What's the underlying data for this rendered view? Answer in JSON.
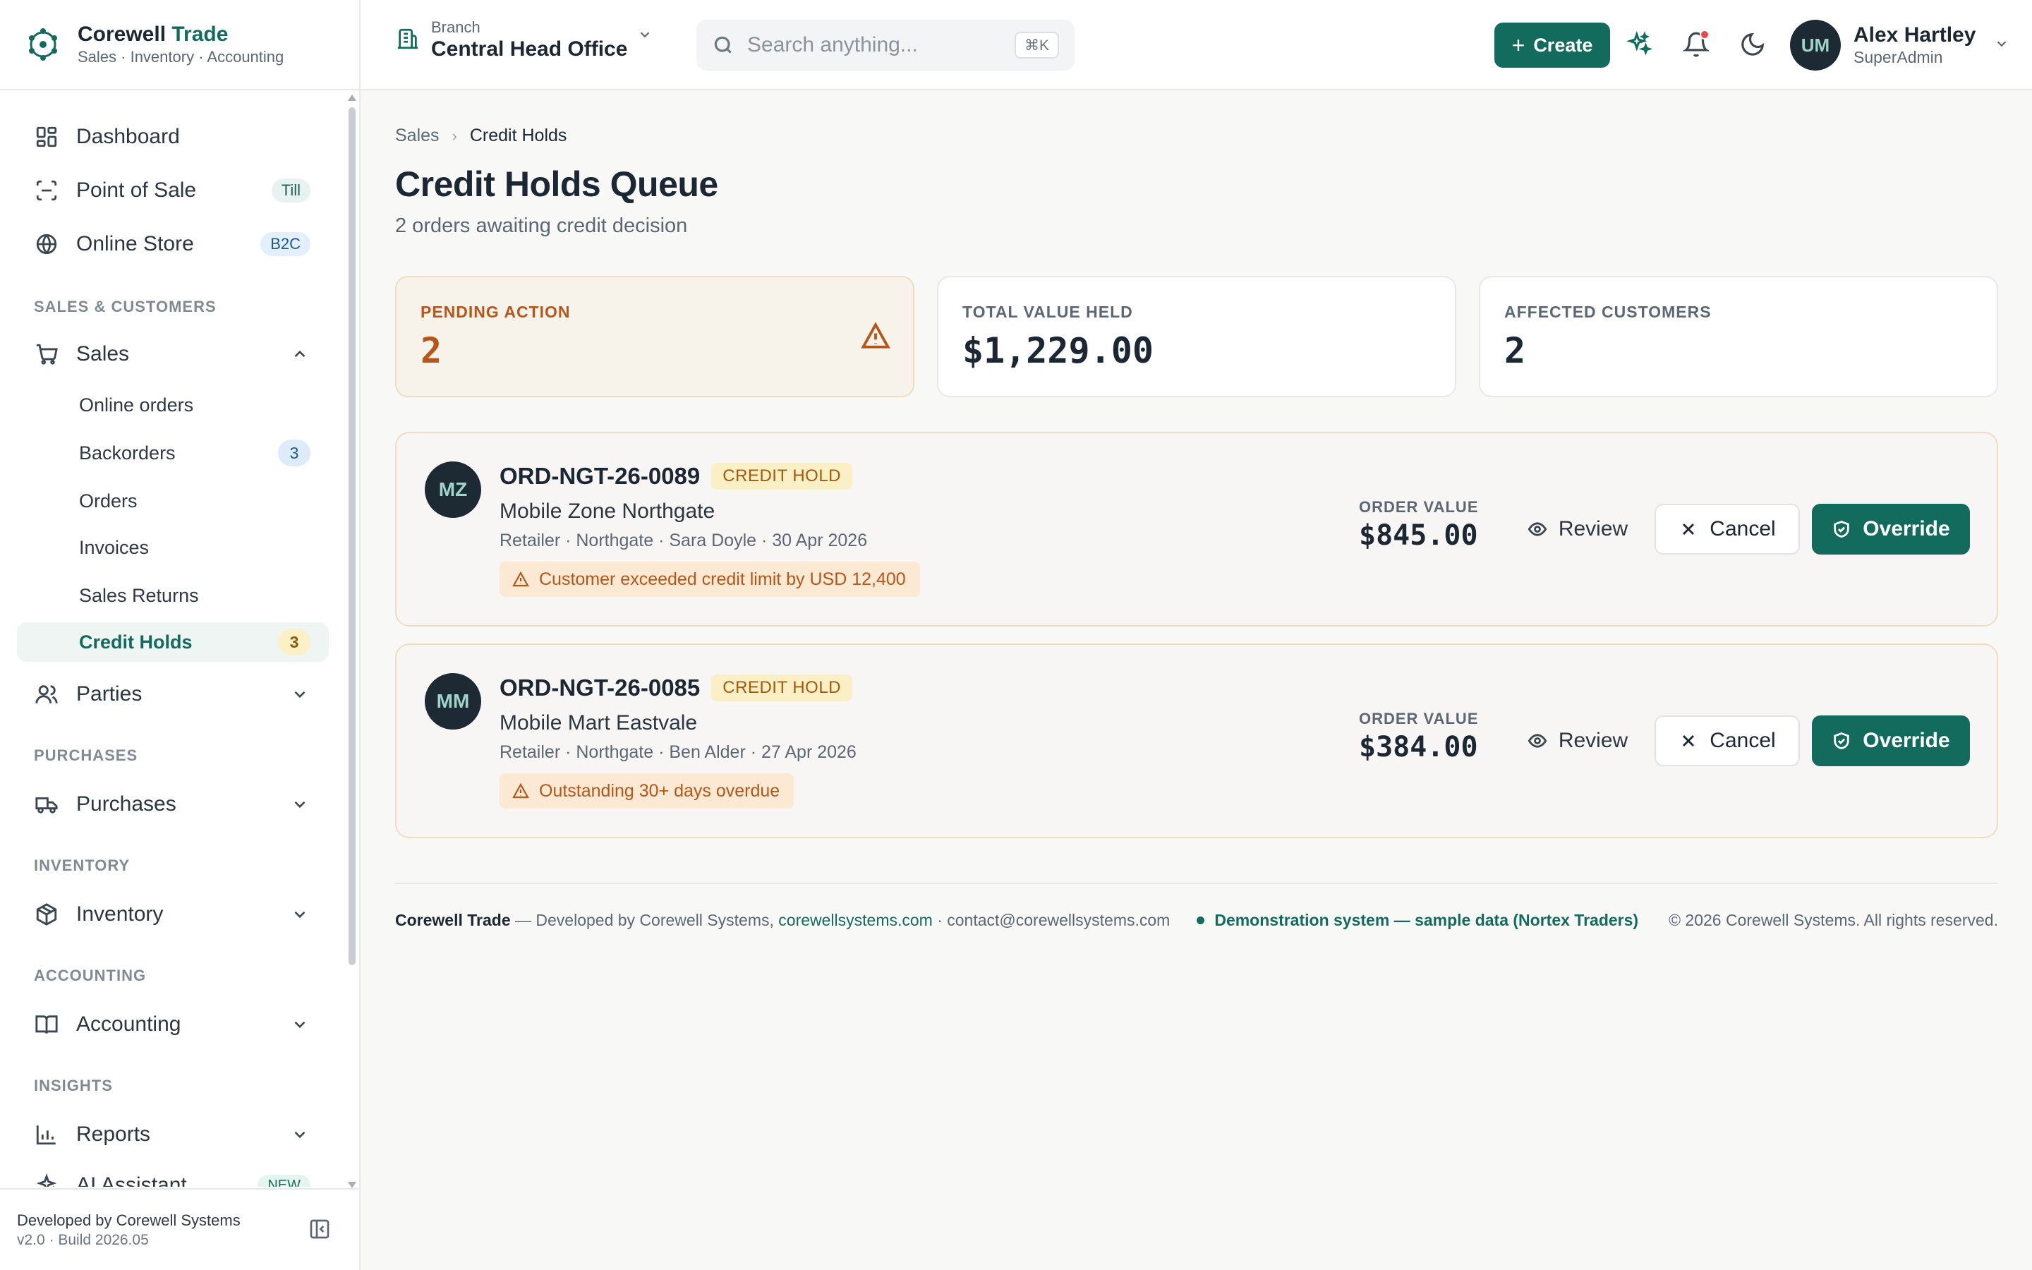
{
  "brand": {
    "name_part1": "Corewell",
    "name_part2": "Trade",
    "subtitle": "Sales · Inventory · Accounting"
  },
  "topbar": {
    "branch_label": "Branch",
    "branch_value": "Central Head Office",
    "search_placeholder": "Search anything...",
    "search_shortcut": "⌘K",
    "create_label": "Create",
    "user_initials": "UM",
    "user_name": "Alex Hartley",
    "user_role": "SuperAdmin"
  },
  "sidebar": {
    "top_items": [
      {
        "label": "Dashboard",
        "icon": "dashboard-icon"
      },
      {
        "label": "Point of Sale",
        "icon": "scan-icon",
        "pill": "Till"
      },
      {
        "label": "Online Store",
        "icon": "globe-icon",
        "pill": "B2C"
      }
    ],
    "sections": {
      "sales_customers": "SALES & CUSTOMERS",
      "purchases": "PURCHASES",
      "inventory": "INVENTORY",
      "accounting": "ACCOUNTING",
      "insights": "INSIGHTS"
    },
    "sales": {
      "label": "Sales",
      "children": [
        {
          "label": "Online orders"
        },
        {
          "label": "Backorders",
          "count": "3"
        },
        {
          "label": "Orders"
        },
        {
          "label": "Invoices"
        },
        {
          "label": "Sales Returns"
        },
        {
          "label": "Credit Holds",
          "count": "3"
        }
      ]
    },
    "parties": "Parties",
    "purchases": "Purchases",
    "inventory": "Inventory",
    "accounting": "Accounting",
    "reports": "Reports",
    "ai_assistant": "AI Assistant",
    "ai_pill": "NEW",
    "footer_line1": "Developed by Corewell Systems",
    "footer_line2": "v2.0 · Build 2026.05"
  },
  "breadcrumb": {
    "parent": "Sales",
    "current": "Credit Holds"
  },
  "page": {
    "title": "Credit Holds Queue",
    "subtitle": "2 orders awaiting credit decision"
  },
  "stats": [
    {
      "label": "PENDING ACTION",
      "value": "2"
    },
    {
      "label": "TOTAL VALUE HELD",
      "value": "$1,229.00"
    },
    {
      "label": "AFFECTED CUSTOMERS",
      "value": "2"
    }
  ],
  "orders": [
    {
      "initials": "MZ",
      "id": "ORD-NGT-26-0089",
      "tag": "CREDIT HOLD",
      "customer": "Mobile Zone Northgate",
      "meta": "Retailer · Northgate · Sara Doyle · 30 Apr 2026",
      "alert": "Customer exceeded credit limit by USD 12,400",
      "value_label": "ORDER VALUE",
      "value": "$845.00"
    },
    {
      "initials": "MM",
      "id": "ORD-NGT-26-0085",
      "tag": "CREDIT HOLD",
      "customer": "Mobile Mart Eastvale",
      "meta": "Retailer · Northgate · Ben Alder · 27 Apr 2026",
      "alert": "Outstanding 30+ days overdue",
      "value_label": "ORDER VALUE",
      "value": "$384.00"
    }
  ],
  "actions": {
    "review": "Review",
    "cancel": "Cancel",
    "override": "Override"
  },
  "footer": {
    "brand": "Corewell Trade",
    "dev_text": " — Developed by Corewell Systems, ",
    "link": "corewellsystems.com",
    "contact": " · contact@corewellsystems.com",
    "demo": "Demonstration system — sample data (Nortex Traders)",
    "copyright": "© 2026 Corewell Systems. All rights reserved."
  },
  "colors": {
    "accent": "#136b5e",
    "amber": "#b5561a",
    "notification": "#e5484d"
  }
}
